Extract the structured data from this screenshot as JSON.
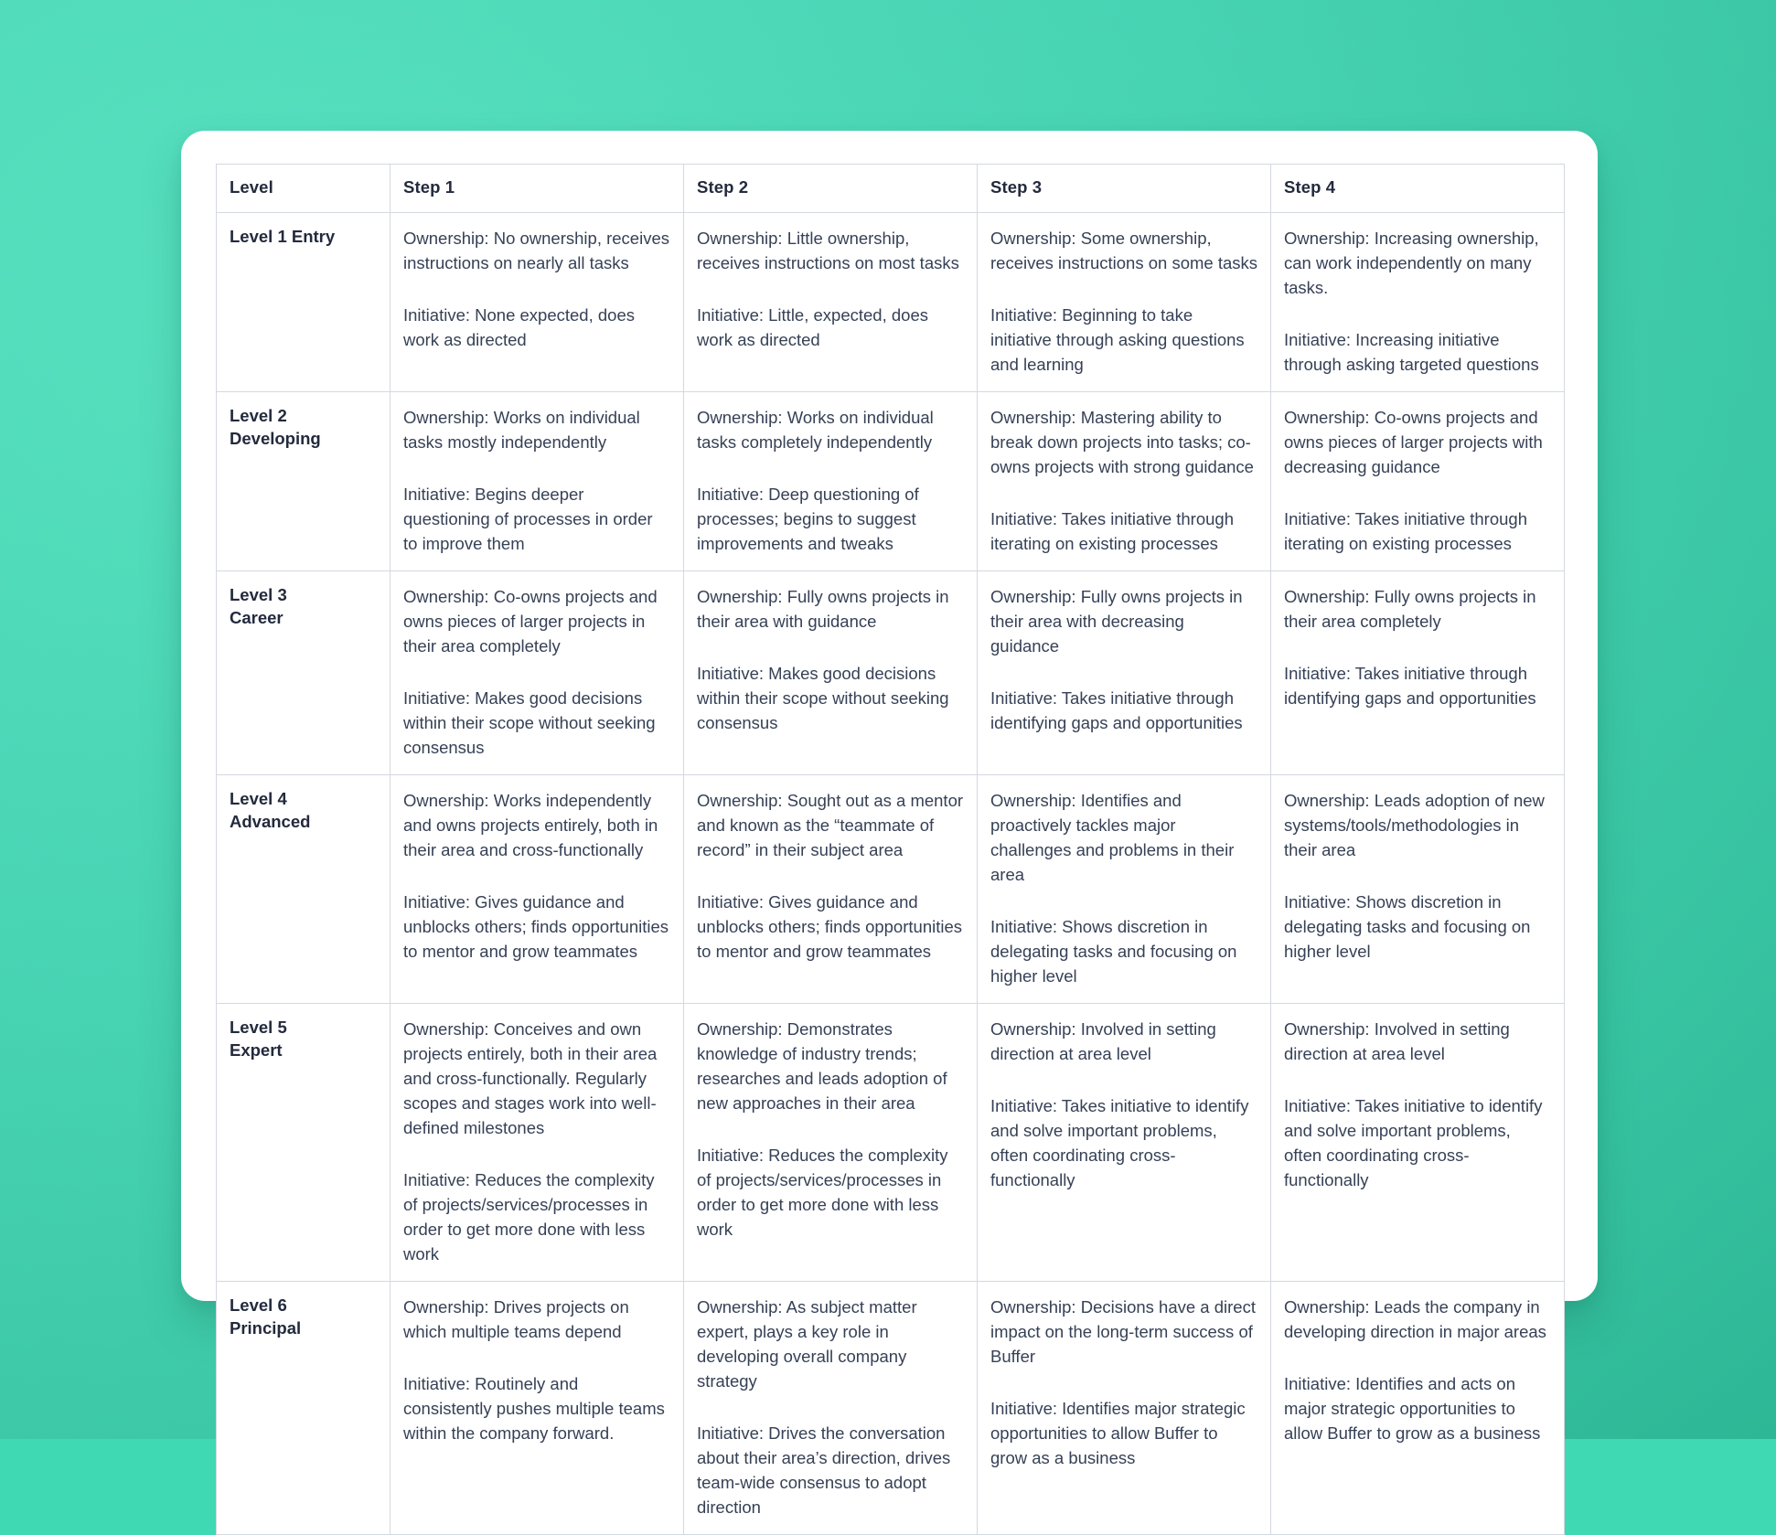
{
  "theme": {
    "background_color": "#3fd9b4",
    "card_color": "#ffffff",
    "text_color": "#364156",
    "heading_color": "#232a3d",
    "border_color": "#d4d8e0"
  },
  "table": {
    "headers": [
      "Level",
      "Step 1",
      "Step 2",
      "Step 3",
      "Step 4"
    ],
    "rows": [
      {
        "level": "Level 1 Entry",
        "steps": [
          {
            "ownership": "Ownership: No ownership, receives instructions on nearly all tasks",
            "initiative": "Initiative: None expected, does work as directed"
          },
          {
            "ownership": "Ownership: Little ownership, receives instructions on most tasks",
            "initiative": "Initiative: Little, expected, does work as directed"
          },
          {
            "ownership": "Ownership: Some ownership, receives instructions on some tasks",
            "initiative": "Initiative: Beginning to take initiative through asking questions and learning"
          },
          {
            "ownership": "Ownership: Increasing ownership, can work independently on many tasks.",
            "initiative": "Initiative: Increasing initiative through asking targeted questions"
          }
        ]
      },
      {
        "level": "Level 2\nDeveloping",
        "steps": [
          {
            "ownership": "Ownership: Works on individual tasks mostly independently",
            "initiative": "Initiative: Begins deeper questioning of processes in order to improve them"
          },
          {
            "ownership": "Ownership: Works on individual tasks completely independently",
            "initiative": "Initiative: Deep questioning of processes; begins to suggest improvements and tweaks"
          },
          {
            "ownership": "Ownership: Mastering ability to break down projects into tasks; co-owns projects with strong guidance",
            "initiative": "Initiative: Takes initiative through iterating on existing processes"
          },
          {
            "ownership": "Ownership: Co-owns projects and owns pieces of larger projects with decreasing guidance",
            "initiative": "Initiative: Takes initiative through iterating on existing processes"
          }
        ]
      },
      {
        "level": "Level 3\nCareer",
        "steps": [
          {
            "ownership": "Ownership: Co-owns projects and owns pieces of larger projects in their area completely",
            "initiative": "Initiative: Makes good decisions within their scope without seeking consensus"
          },
          {
            "ownership": "Ownership: Fully owns projects in their area with guidance",
            "initiative": "Initiative: Makes good decisions within their scope without seeking consensus"
          },
          {
            "ownership": "Ownership: Fully owns projects in their area with decreasing guidance",
            "initiative": "Initiative: Takes initiative through identifying gaps and opportunities"
          },
          {
            "ownership": "Ownership: Fully owns projects in their area completely",
            "initiative": "Initiative: Takes initiative through identifying gaps and opportunities"
          }
        ]
      },
      {
        "level": "Level 4\nAdvanced",
        "steps": [
          {
            "ownership": "Ownership: Works independently and owns projects entirely, both in their area and cross-functionally",
            "initiative": "Initiative: Gives guidance and unblocks others; finds opportunities to mentor and grow teammates"
          },
          {
            "ownership": "Ownership: Sought out as a mentor and known as the “teammate of record” in their subject area",
            "initiative": "Initiative: Gives guidance and unblocks others; finds opportunities to mentor and grow teammates"
          },
          {
            "ownership": "Ownership: Identifies and proactively tackles major challenges and problems in their area",
            "initiative": "Initiative: Shows discretion in delegating tasks and focusing on higher level"
          },
          {
            "ownership": "Ownership: Leads adoption of new systems/tools/methodologies in their area",
            "initiative": "Initiative: Shows discretion in delegating tasks and focusing on higher level"
          }
        ]
      },
      {
        "level": "Level 5\nExpert",
        "steps": [
          {
            "ownership": "Ownership: Conceives and own projects entirely, both in their area and cross-functionally. Regularly scopes and stages work into well-defined milestones",
            "initiative": "Initiative: Reduces the complexity of projects/services/processes in order to get more done with less work"
          },
          {
            "ownership": "Ownership: Demonstrates knowledge of industry trends; researches and leads adoption of new approaches in their area",
            "initiative": "Initiative: Reduces the complexity of projects/services/processes in order to get more done with less work"
          },
          {
            "ownership": "Ownership: Involved in setting direction at area level",
            "initiative": "Initiative: Takes initiative to identify and solve important problems, often coordinating cross-functionally"
          },
          {
            "ownership": "Ownership: Involved in setting direction at area level",
            "initiative": "Initiative: Takes initiative to identify and solve important problems, often coordinating cross-functionally"
          }
        ]
      },
      {
        "level": "Level 6\nPrincipal",
        "steps": [
          {
            "ownership": "Ownership: Drives projects on which multiple teams depend",
            "initiative": "Initiative: Routinely and consistently pushes multiple teams within the company forward."
          },
          {
            "ownership": "Ownership: As subject matter expert, plays a key role in developing overall company strategy",
            "initiative": "Initiative: Drives the conversation about their area’s direction, drives team-wide consensus to adopt direction"
          },
          {
            "ownership": "Ownership: Decisions have a direct impact on the long-term success of Buffer",
            "initiative": "Initiative: Identifies major strategic opportunities to allow Buffer to grow as a business"
          },
          {
            "ownership": "Ownership: Leads the company in developing direction in major areas",
            "initiative": "Initiative: Identifies and acts on major strategic opportunities to allow Buffer to grow as a business"
          }
        ]
      }
    ]
  }
}
